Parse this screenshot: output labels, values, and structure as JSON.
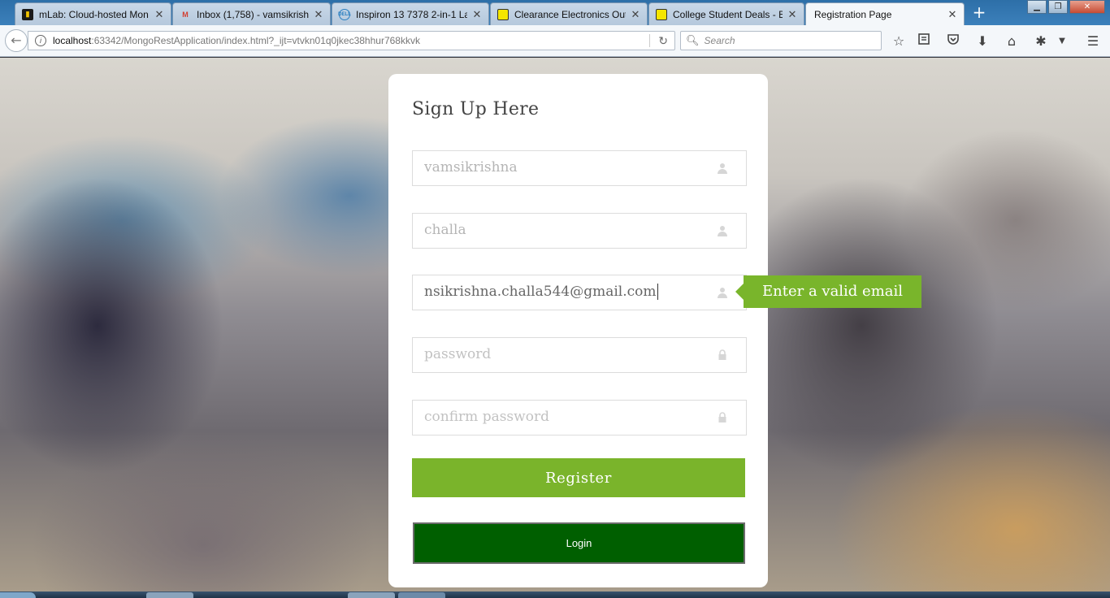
{
  "browser": {
    "tabs": [
      {
        "title": "mLab: Cloud-hosted Mon",
        "favicon": "mlab-icon",
        "active": false
      },
      {
        "title": "Inbox (1,758) - vamsikrishn",
        "favicon": "gmail-icon",
        "active": false
      },
      {
        "title": "Inspiron 13 7378 2-in-1 Lap",
        "favicon": "dell-icon",
        "active": false
      },
      {
        "title": "Clearance Electronics Outl",
        "favicon": "bestbuy-icon",
        "active": false
      },
      {
        "title": "College Student Deals - Be",
        "favicon": "bestbuy-icon",
        "active": false
      },
      {
        "title": "Registration Page",
        "favicon": "",
        "active": true
      }
    ],
    "url_host": "localhost",
    "url_rest": ":63342/MongoRestApplication/index.html?_ijt=vtvkn01q0jkec38hhur768kkvk",
    "search_placeholder": "Search"
  },
  "form": {
    "title": "Sign Up Here",
    "first_name": {
      "value": "vamsikrishna"
    },
    "last_name": {
      "value": "challa"
    },
    "email": {
      "value": "nsikrishna.challa544@gmail.com"
    },
    "password": {
      "placeholder": "password"
    },
    "confirm_password": {
      "placeholder": "confirm password"
    },
    "validation_message": "Enter a valid email",
    "register_label": "Register",
    "login_label": "Login"
  },
  "colors": {
    "accent_green": "#7ab42b",
    "login_green": "#005f00"
  }
}
